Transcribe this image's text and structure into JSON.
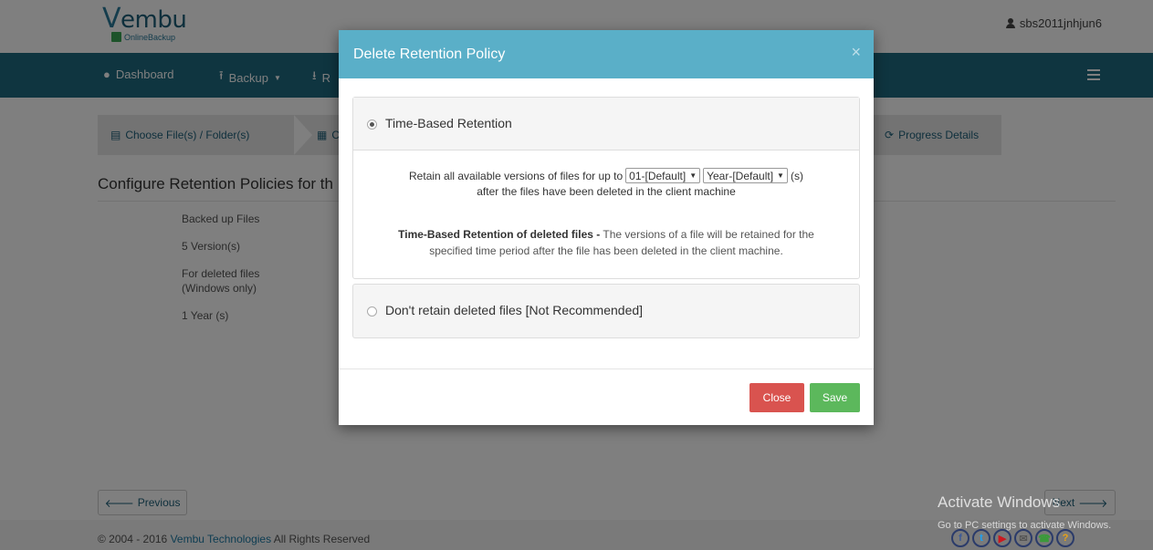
{
  "header": {
    "logo_text": "embu",
    "logo_v": "V",
    "logo_sub": "OnlineBackup",
    "user": "sbs2011jnhjun6"
  },
  "nav": {
    "dashboard": "Dashboard",
    "backup": "Backup",
    "restore_fragment": "R"
  },
  "steps": {
    "choose": "Choose File(s) / Folder(s)",
    "second_fragment": "C",
    "progress": "Progress Details"
  },
  "page": {
    "section_title": "Configure Retention Policies for th",
    "items": [
      "Backed up Files",
      "5 Version(s)",
      "For deleted files",
      "(Windows only)",
      "1 Year (s)"
    ],
    "prev": "Previous",
    "next": "Next"
  },
  "footer": {
    "copyright": "© 2004 - 2016",
    "company": "Vembu Technologies",
    "rights": "All Rights Reserved"
  },
  "watermark": {
    "title": "Activate Windows",
    "sub": "Go to PC settings to activate Windows."
  },
  "modal": {
    "title": "Delete Retention Policy",
    "close_x": "×",
    "option1": "Time-Based Retention",
    "retain_prefix": "Retain all available versions of files for up to",
    "period_value": "01-[Default]",
    "unit_value": "Year-[Default]",
    "unit_suffix": "(s)",
    "retain_line2": "after the files have been deleted in the client machine",
    "desc_bold": "Time-Based Retention of deleted files -",
    "desc_text": " The versions of a file will be retained for the",
    "desc_line2": "specified time period after the file has been deleted in the client machine.",
    "option2": "Don't retain deleted files [Not Recommended]",
    "close_btn": "Close",
    "save_btn": "Save"
  },
  "colors": {
    "nav": "#1f6b80",
    "modal_header": "#5aafc8",
    "close": "#d9534f",
    "save": "#5cb85c"
  }
}
